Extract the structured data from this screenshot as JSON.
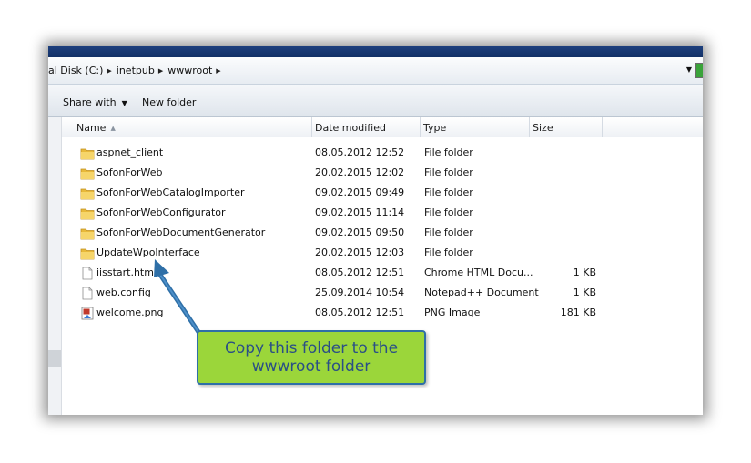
{
  "address": {
    "breadcrumb": [
      "al Disk (C:)",
      "inetpub",
      "wwwroot"
    ],
    "separator_icon": "chevron-right-icon"
  },
  "toolbar": {
    "share_label": "Share with",
    "new_folder_label": "New folder"
  },
  "columns": {
    "name": "Name",
    "date": "Date modified",
    "type": "Type",
    "size": "Size"
  },
  "files": [
    {
      "name": "aspnet_client",
      "date": "08.05.2012 12:52",
      "type": "File folder",
      "size": "",
      "icon": "folder-icon"
    },
    {
      "name": "SofonForWeb",
      "date": "20.02.2015 12:02",
      "type": "File folder",
      "size": "",
      "icon": "folder-icon"
    },
    {
      "name": "SofonForWebCatalogImporter",
      "date": "09.02.2015 09:49",
      "type": "File folder",
      "size": "",
      "icon": "folder-icon"
    },
    {
      "name": "SofonForWebConfigurator",
      "date": "09.02.2015 11:14",
      "type": "File folder",
      "size": "",
      "icon": "folder-icon"
    },
    {
      "name": "SofonForWebDocumentGenerator",
      "date": "09.02.2015 09:50",
      "type": "File folder",
      "size": "",
      "icon": "folder-icon"
    },
    {
      "name": "UpdateWpoInterface",
      "date": "20.02.2015 12:03",
      "type": "File folder",
      "size": "",
      "icon": "folder-icon"
    },
    {
      "name": "iisstart.htm",
      "date": "08.05.2012 12:51",
      "type": "Chrome HTML Docu...",
      "size": "1 KB",
      "icon": "html-file-icon"
    },
    {
      "name": "web.config",
      "date": "25.09.2014 10:54",
      "type": "Notepad++ Document",
      "size": "1 KB",
      "icon": "document-file-icon"
    },
    {
      "name": "welcome.png",
      "date": "08.05.2012 12:51",
      "type": "PNG Image",
      "size": "181 KB",
      "icon": "image-file-icon"
    }
  ],
  "callout": {
    "line1": "Copy this folder to the",
    "line2": "wwwroot folder"
  },
  "colors": {
    "titlebar": "#1d3f7d",
    "callout_fill": "#9bd63a",
    "callout_border": "#2e6fa7",
    "callout_text": "#2a4f86",
    "folder": "#e8b93a"
  }
}
